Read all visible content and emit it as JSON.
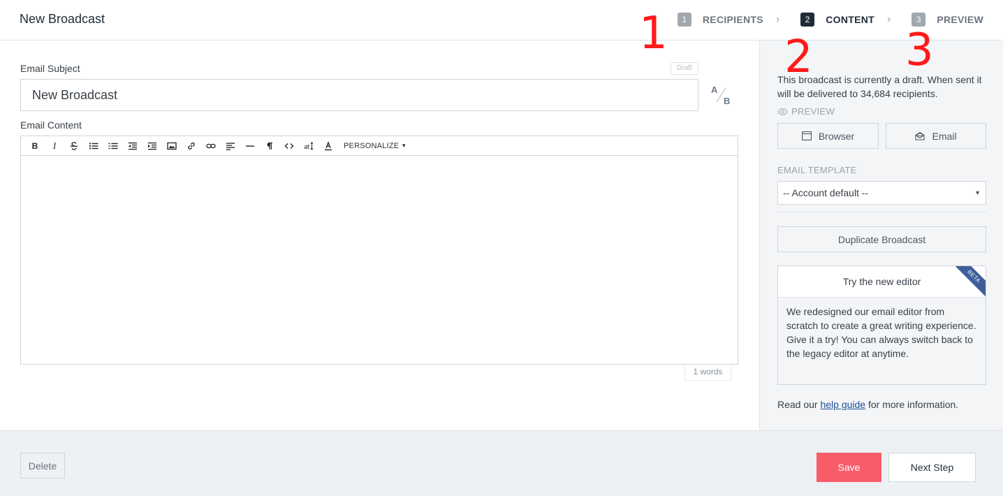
{
  "header": {
    "title": "New Broadcast",
    "steps": [
      {
        "num": "1",
        "label": "RECIPIENTS"
      },
      {
        "num": "2",
        "label": "CONTENT"
      },
      {
        "num": "3",
        "label": "PREVIEW"
      }
    ],
    "chevron": "›"
  },
  "annotations": [
    "1",
    "2",
    "3"
  ],
  "editor": {
    "subject_label": "Email Subject",
    "draft_badge": "Draft",
    "subject_value": "New Broadcast",
    "ab_a": "A",
    "ab_b": "B",
    "content_label": "Email Content",
    "toolbar": {
      "bold": "B",
      "italic": "I",
      "personalize": "PERSONALIZE"
    },
    "word_count": "1 words"
  },
  "sidebar": {
    "status_text": "This broadcast is currently a draft. When sent it will be delivered to 34,684 recipients.",
    "preview_label": "PREVIEW",
    "browser_button": "Browser",
    "email_button": "Email",
    "template_label": "EMAIL TEMPLATE",
    "template_value": "-- Account default --",
    "duplicate_button": "Duplicate Broadcast",
    "card": {
      "badge": "BETA",
      "title": "Try the new editor",
      "body": "We redesigned our email editor from scratch to create a great writing experience. Give it a try! You can always switch back to the legacy editor at anytime."
    },
    "help": {
      "prefix": "Read our ",
      "link": "help guide",
      "suffix": " for more information."
    }
  },
  "footer": {
    "delete_button": "Delete",
    "save_button": "Save",
    "next_button": "Next Step"
  },
  "colors": {
    "accent_save": "#f75c68",
    "active_step": "#1f2b38",
    "beta_ribbon": "#3e5e9a",
    "annotation": "#ff1a1a"
  }
}
